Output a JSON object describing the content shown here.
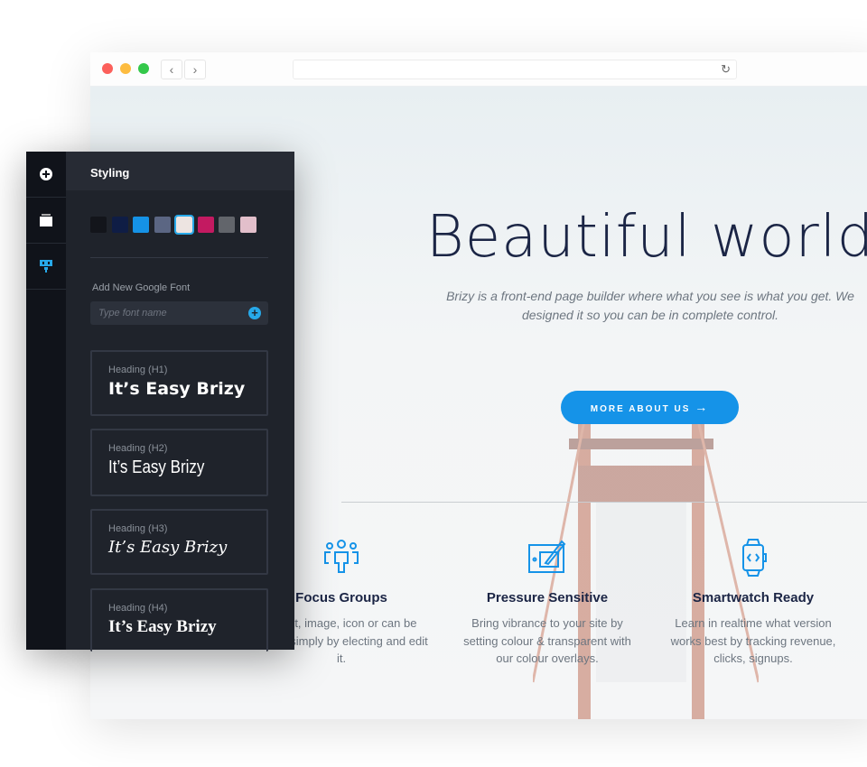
{
  "browser": {
    "traffic_colors": [
      "#fc605b",
      "#fdbc40",
      "#34c84a"
    ],
    "back": "‹",
    "forward": "›",
    "reload_icon": "↻"
  },
  "hero": {
    "title": "Beautiful world",
    "subtitle": "Brizy is a front-end page builder where what you see is what you get. We designed it so you can be in complete control.",
    "button": "MORE ABOUT US",
    "button_arrow": "→",
    "accent": "#1593e8"
  },
  "features": [
    {
      "icon": "users-icon",
      "title": "Focus Groups",
      "text": "ry text, image, icon or can be edited simply by electing and edit it."
    },
    {
      "icon": "tablet-pen-icon",
      "title": "Pressure Sensitive",
      "text": "Bring vibrance to your site by setting colour & transparent with our colour overlays."
    },
    {
      "icon": "smartwatch-icon",
      "title": "Smartwatch Ready",
      "text": "Learn in realtime what version works best by tracking revenue, clicks, signups."
    }
  ],
  "panel": {
    "title": "Styling",
    "swatches": [
      "#13151b",
      "#0f1d45",
      "#1592e6",
      "#5b6683",
      "#ede4e1",
      "#c31a61",
      "#62656b",
      "#e2bfcb"
    ],
    "selected_swatch": 4,
    "font_label": "Add New Google Font",
    "font_placeholder": "Type font name",
    "headings": [
      {
        "label": "Heading (H1)",
        "sample": "It’s Easy Brizy"
      },
      {
        "label": "Heading (H2)",
        "sample": "It’s Easy Brizy"
      },
      {
        "label": "Heading (H3)",
        "sample": "It’s Easy Brizy"
      },
      {
        "label": "Heading (H4)",
        "sample": "It’s Easy Brizy"
      }
    ]
  }
}
